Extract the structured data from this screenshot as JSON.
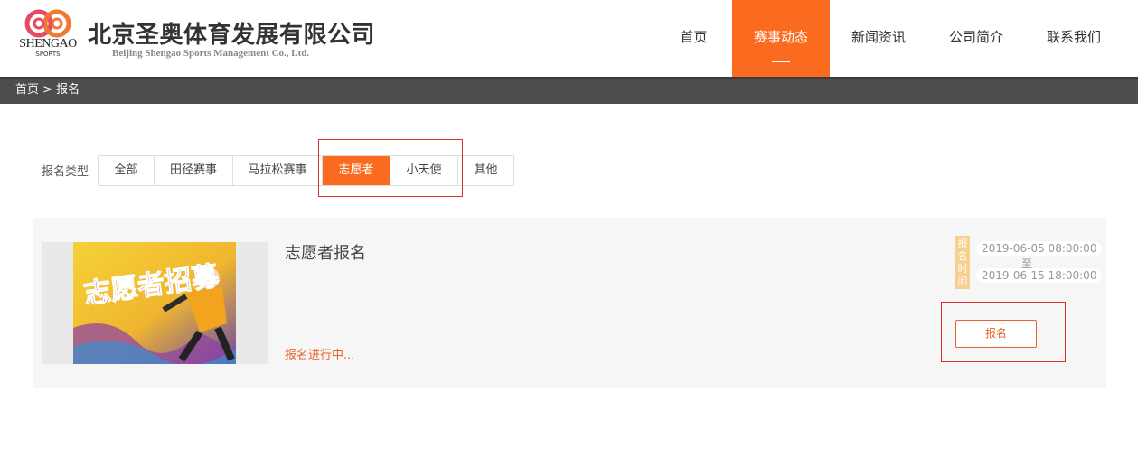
{
  "brand": {
    "logo_text": "SHENGAO",
    "logo_sub": "SPORTS",
    "company_cn": "北京圣奥体育发展有限公司",
    "company_en": "Beijing Shengao Sports Management Co., Ltd.",
    "accent_color": "#fb6b1f"
  },
  "nav": {
    "items": [
      {
        "label": "首页",
        "active": false
      },
      {
        "label": "赛事动态",
        "active": true
      },
      {
        "label": "新闻资讯",
        "active": false
      },
      {
        "label": "公司简介",
        "active": false
      },
      {
        "label": "联系我们",
        "active": false
      }
    ]
  },
  "breadcrumb": {
    "text": "首页 > 报名"
  },
  "filter": {
    "label": "报名类型",
    "options": [
      {
        "label": "全部",
        "active": false
      },
      {
        "label": "田径赛事",
        "active": false
      },
      {
        "label": "马拉松赛事",
        "active": false
      },
      {
        "label": "志愿者",
        "active": true
      },
      {
        "label": "小天使",
        "active": false
      },
      {
        "label": "其他",
        "active": false
      }
    ]
  },
  "event": {
    "title": "志愿者报名",
    "status": "报名进行中...",
    "time_tag": "报名时间",
    "start": "2019-06-05 08:00:00",
    "to": "至",
    "end": "2019-06-15 18:00:00",
    "signup_label": "报名",
    "image_text": "志愿者招募"
  }
}
